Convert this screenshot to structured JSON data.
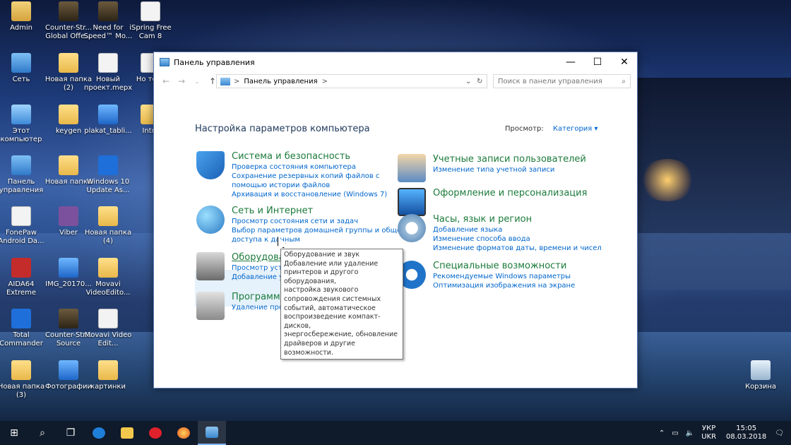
{
  "desktop": {
    "icons": [
      {
        "label": "Admin",
        "icon": "user-folder-icon"
      },
      {
        "label": "Counter-Str... Global Offe...",
        "icon": "game-icon"
      },
      {
        "label": "Need for Speed™ Mo...",
        "icon": "game-icon"
      },
      {
        "label": "iSpring Free Cam 8",
        "icon": "app-icon"
      },
      {
        "label": "Сеть",
        "icon": "network-icon"
      },
      {
        "label": "Новая папка (2)",
        "icon": "folder-icon"
      },
      {
        "label": "Новый проект.mepx",
        "icon": "document-icon"
      },
      {
        "label": "Но текс",
        "icon": "document-icon"
      },
      {
        "label": "Этот компьютер",
        "icon": "computer-icon"
      },
      {
        "label": "keygen",
        "icon": "folder-icon"
      },
      {
        "label": "plakat_tabli...",
        "icon": "image-icon"
      },
      {
        "label": "Intro",
        "icon": "folder-icon"
      },
      {
        "label": "Панель управления",
        "icon": "control-panel-icon"
      },
      {
        "label": "Новая папка",
        "icon": "folder-icon"
      },
      {
        "label": "Windows 10 Update As...",
        "icon": "windows-icon"
      },
      {
        "label": "FonePaw Android Da...",
        "icon": "app-icon"
      },
      {
        "label": "Viber",
        "icon": "viber-icon"
      },
      {
        "label": "Новая папка (4)",
        "icon": "folder-icon"
      },
      {
        "label": "AIDA64 Extreme",
        "icon": "aida-icon"
      },
      {
        "label": "IMG_20170...",
        "icon": "image-icon"
      },
      {
        "label": "Movavi VideoEdito...",
        "icon": "folder-icon"
      },
      {
        "label": "Total Commander",
        "icon": "disk-icon"
      },
      {
        "label": "Counter-Str... Source",
        "icon": "game-icon"
      },
      {
        "label": "Movavi Video Edit...",
        "icon": "app-icon"
      },
      {
        "label": "Новая папка (3)",
        "icon": "folder-icon"
      },
      {
        "label": "Фотографии",
        "icon": "photos-icon"
      },
      {
        "label": "картинки",
        "icon": "folder-icon"
      },
      {
        "label": "Корзина",
        "icon": "recycle-bin-icon"
      }
    ]
  },
  "window": {
    "title": "Панель управления",
    "buttons": {
      "minimize": "—",
      "maximize": "☐",
      "close": "✕"
    },
    "address": {
      "crumb": "Панель управления",
      "sep": ">"
    },
    "search_placeholder": "Поиск в панели управления",
    "heading": "Настройка параметров компьютера",
    "view_label": "Просмотр:",
    "view_value": "Категория",
    "left": [
      {
        "title": "Система и безопасность",
        "icon": "shield-icon",
        "links": [
          "Проверка состояния компьютера",
          "Сохранение резервных копий файлов с",
          "помощью истории файлов",
          "Архивация и восстановление (Windows 7)"
        ]
      },
      {
        "title": "Сеть и Интернет",
        "icon": "network-globe-icon",
        "links": [
          "Просмотр состояния сети и задач",
          "Выбор параметров домашней группы и общего",
          "доступа к данным"
        ]
      },
      {
        "title": "Оборудование и звук",
        "icon": "printer-icon",
        "links": [
          "Просмотр устройств и принтеров",
          "Добавление ус"
        ]
      },
      {
        "title": "Программы",
        "icon": "programs-icon",
        "links": [
          "Удаление прог"
        ]
      }
    ],
    "right": [
      {
        "title": "Учетные записи пользователей",
        "icon": "users-icon",
        "links": [
          "Изменение типа учетной записи"
        ]
      },
      {
        "title": "Оформление и персонализация",
        "icon": "monitor-icon",
        "links": []
      },
      {
        "title": "Часы, язык и регион",
        "icon": "clock-icon",
        "links": [
          "Добавление языка",
          "Изменение способа ввода",
          "Изменение форматов даты, времени и чисел"
        ]
      },
      {
        "title": "Специальные возможности",
        "icon": "accessibility-icon",
        "links": [
          "Рекомендуемые Windows параметры",
          "Оптимизация изображения на экране"
        ]
      }
    ],
    "tooltip": "Оборудование и звук\nДобавление или удаление\nпринтеров и другого оборудования,\nнастройка звукового\nсопровождения системных\nсобытий, автоматическое\nвоспроизведение компакт-дисков,\nэнергосбережение, обновление\nдрайверов и другие возможности."
  },
  "taskbar": {
    "lang_top": "УКР",
    "lang_bottom": "UKR",
    "time": "15:05",
    "date": "08.03.2018"
  }
}
